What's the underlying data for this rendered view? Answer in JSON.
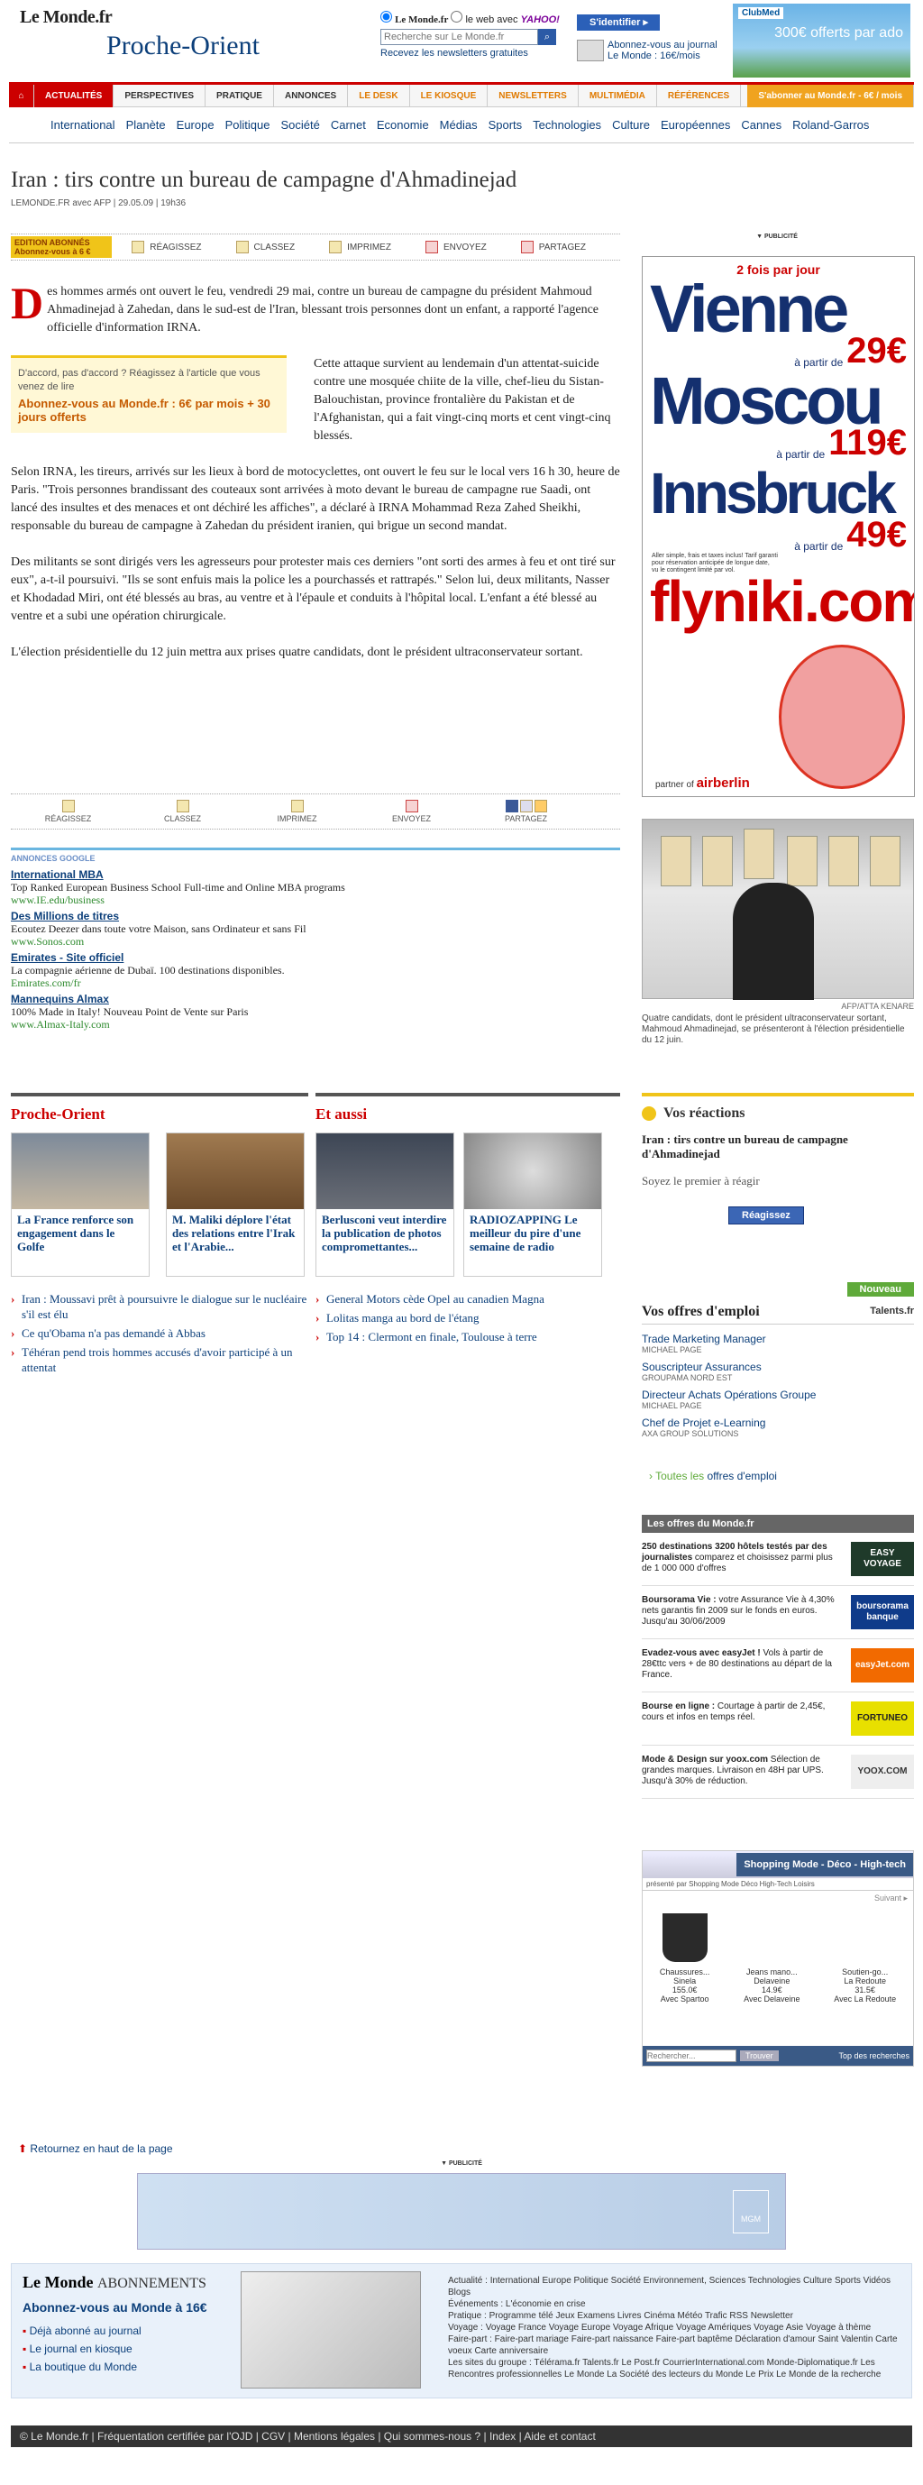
{
  "header": {
    "logo": "Le Monde.fr",
    "section": "Proche-Orient",
    "search_label_lemonde": "Le Monde.fr",
    "search_label_web": "le web avec",
    "yahoo": "YAHOO!",
    "search_placeholder": "Recherche sur Le Monde.fr",
    "newsletters": "Recevez les newsletters gratuites",
    "identify_button": "S'identifier ▸",
    "subscribe_text": "Abonnez-vous au journal Le Monde : 16€/mois",
    "ad_brand": "ClubMed",
    "ad_price": "300€ offerts par ado"
  },
  "nav": {
    "primary": [
      "ACTUALITÉS",
      "PERSPECTIVES",
      "PRATIQUE",
      "ANNONCES",
      "LE DESK",
      "LE KIOSQUE",
      "NEWSLETTERS",
      "MULTIMÉDIA",
      "RÉFÉRENCES"
    ],
    "subscribe": "S'abonner au Monde.fr - 6€ / mois",
    "secondary": [
      "International",
      "Planète",
      "Europe",
      "Politique",
      "Société",
      "Carnet",
      "Economie",
      "Médias",
      "Sports",
      "Technologies",
      "Culture",
      "Européennes",
      "Cannes",
      "Roland-Garros"
    ]
  },
  "article": {
    "title": "Iran : tirs contre un bureau de campagne d'Ahmadinejad",
    "meta": "LEMONDE.FR avec AFP | 29.05.09 | 19h36",
    "edition_badge": "EDITION ABONNÉS Abonnez-vous à 6 €",
    "tools": [
      "RÉAGISSEZ",
      "CLASSEZ",
      "IMPRIMEZ",
      "ENVOYEZ",
      "PARTAGEZ"
    ],
    "dropcap": "D",
    "p1": "es hommes armés ont ouvert le feu, vendredi 29 mai, contre un bureau de campagne du président Mahmoud Ahmadinejad à Zahedan, dans le sud-est de l'Iran, blessant trois personnes dont un enfant, a rapporté l'agence officielle d'information IRNA.",
    "react_q": "D'accord, pas d'accord ? Réagissez à l'article que vous venez de lire",
    "react_cta": "Abonnez-vous au Monde.fr : 6€ par mois + 30 jours offerts",
    "p2": "Cette attaque survient au lendemain d'un attentat-suicide contre une mosquée chiite de la ville, chef-lieu du Sistan-Balouchistan, province frontalière du Pakistan et de l'Afghanistan, qui a fait vingt-cinq morts et cent vingt-cinq blessés.",
    "p3": "Selon IRNA, les tireurs, arrivés sur les lieux à bord de motocyclettes, ont ouvert le feu sur le local vers 16 h 30, heure de Paris. \"Trois personnes brandissant des couteaux sont arrivées à moto devant le bureau de campagne rue Saadi, ont lancé des insultes et des menaces et ont déchiré les affiches\", a déclaré à IRNA Mohammad Reza Zahed Sheikhi, responsable du bureau de campagne à Zahedan du président iranien, qui brigue un second mandat.",
    "p4": "Des militants se sont dirigés vers les agresseurs pour protester mais ces derniers \"ont sorti des armes à feu et ont tiré sur eux\", a-t-il poursuivi. \"Ils se sont enfuis mais la police les a pourchassés et rattrapés.\" Selon lui, deux militants, Nasser et Khodadad Miri, ont été blessés au bras, au ventre et à l'épaule et conduits à l'hôpital local. L'enfant a été blessé au ventre et a subi une opération chirurgicale.",
    "p5": "L'élection présidentielle du 12 juin mettra aux prises quatre candidats, dont le président ultraconservateur sortant."
  },
  "ads": {
    "header": "ANNONCES GOOGLE",
    "items": [
      {
        "title": "International MBA",
        "desc": "Top Ranked European Business School Full-time and Online MBA programs",
        "url": "www.IE.edu/business"
      },
      {
        "title": "Des Millions de titres",
        "desc": "Ecoutez Deezer dans toute votre Maison, sans Ordinateur et sans Fil",
        "url": "www.Sonos.com"
      },
      {
        "title": "Emirates - Site officiel",
        "desc": "La compagnie aérienne de Dubaï. 100 destinations disponibles.",
        "url": "Emirates.com/fr"
      },
      {
        "title": "Mannequins Almax",
        "desc": "100% Made in Italy! Nouveau Point de Vente sur Paris",
        "url": "www.Almax-Italy.com"
      }
    ]
  },
  "sidebar": {
    "pub_label": "▼ PUBLICITÉ",
    "flyniki": {
      "top": "2 fois par jour",
      "cities": [
        {
          "name": "Vienne",
          "from": "à partir de",
          "price": "29€"
        },
        {
          "name": "Moscou",
          "from": "à partir de",
          "price": "119€"
        },
        {
          "name": "Innsbruck",
          "from": "à partir de",
          "price": "49€"
        }
      ],
      "small": "Aller simple, frais et taxes inclus! Tarif garanti pour réservation anticipée de longue date, vu le contingent limité par vol.",
      "brand": "flyniki.com",
      "partner": "partner of",
      "partner_brand": "airberlin"
    },
    "photo_credit": "AFP/ATTA KENARE",
    "photo_caption": "Quatre candidats, dont le président ultraconservateur sortant, Mahmoud Ahmadinejad, se présenteront à l'élection présidentielle du 12 juin."
  },
  "sections": {
    "po_title": "Proche-Orient",
    "po_cards": [
      "La France renforce son engagement dans le Golfe",
      "M. Maliki déplore l'état des relations entre l'Irak et l'Arabie..."
    ],
    "po_links": [
      "Iran : Moussavi prêt à poursuivre le dialogue sur le nucléaire s'il est élu",
      "Ce qu'Obama n'a pas demandé à Abbas",
      "Téhéran pend trois hommes accusés d'avoir participé à un attentat"
    ],
    "ea_title": "Et aussi",
    "ea_cards": [
      "Berlusconi veut interdire la publication de photos compromettantes...",
      "RADIOZAPPING Le meilleur du pire d'une semaine de radio"
    ],
    "ea_links": [
      "General Motors cède Opel au canadien Magna",
      "Lolitas manga au bord de l'étang",
      "Top 14 : Clermont en finale, Toulouse à terre"
    ]
  },
  "reactions": {
    "title": "Vos réactions",
    "article": "Iran : tirs contre un bureau de campagne d'Ahmadinejad",
    "first": "Soyez le premier à réagir",
    "button": "Réagissez"
  },
  "jobs": {
    "badge": "Nouveau",
    "title": "Vos offres d'emploi",
    "partner": "Talents.fr",
    "items": [
      {
        "title": "Trade Marketing Manager",
        "company": "MICHAEL PAGE"
      },
      {
        "title": "Souscripteur Assurances",
        "company": "GROUPAMA NORD EST"
      },
      {
        "title": "Directeur Achats Opérations Groupe",
        "company": "MICHAEL PAGE"
      },
      {
        "title": "Chef de Projet e-Learning",
        "company": "AXA GROUP SOLUTIONS"
      }
    ],
    "all_prefix": "› Toutes les",
    "all_link": "offres d'emploi"
  },
  "offres": {
    "title": "Les offres du Monde.fr",
    "items": [
      {
        "bold": "250 destinations 3200 hôtels testés par des journalistes",
        "text": " comparez et choisissez parmi plus de 1 000 000 d'offres",
        "logo": "EASY VOYAGE",
        "bg": "#1f3a2a",
        "fg": "#ffffff"
      },
      {
        "bold": "Boursorama Vie :",
        "text": " votre Assurance Vie à 4,30% nets garantis fin 2009 sur le fonds en euros. Jusqu'au 30/06/2009",
        "logo": "boursorama banque",
        "bg": "#0f3b8a",
        "fg": "#ffffff"
      },
      {
        "bold": "Evadez-vous avec easyJet !",
        "text": " Vols à partir de 28€ttc vers + de 80 destinations au départ de la France.",
        "logo": "easyJet.com",
        "bg": "#f26a00",
        "fg": "#ffffff"
      },
      {
        "bold": "Bourse en ligne :",
        "text": " Courtage à partir de 2,45€, cours et infos en temps réel.",
        "logo": "FORTUNEO",
        "bg": "#e8e000",
        "fg": "#222222"
      },
      {
        "bold": "Mode & Design sur yoox.com",
        "text": " Sélection de grandes marques. Livraison en 48H par UPS. Jusqu'à 30% de réduction.",
        "logo": "YOOX.COM",
        "bg": "#eeeeee",
        "fg": "#333333"
      }
    ]
  },
  "shop": {
    "title": "Shopping Mode - Déco - High-tech",
    "tabs": [
      "présenté par Shopping",
      "Mode",
      "Déco",
      "High-Tech",
      "Loisirs"
    ],
    "next": "Suivant ▸",
    "products": [
      {
        "name": "Chaussures...",
        "brand": "Sinela",
        "price": "155.0€",
        "shop": "Avec Spartoo"
      },
      {
        "name": "Jeans mano...",
        "brand": "Delaveine",
        "price": "14.9€",
        "shop": "Avec Delaveine"
      },
      {
        "name": "Soutien-go...",
        "brand": "La Redoute",
        "price": "31.5€",
        "shop": "Avec La Redoute"
      }
    ],
    "search_placeholder": "Rechercher...",
    "search_btn": "Trouver",
    "top": "Top des recherches"
  },
  "footer": {
    "backtop": "Retournez en haut de la page",
    "pub_label": "▼ PUBLICITÉ",
    "banner_logo": "MGM",
    "lm_logo": "Le Monde",
    "lm_sub": "ABONNEMENTS",
    "abo": "Abonnez-vous au Monde à 16€",
    "links": [
      "Déjà abonné au journal",
      "Le journal en kiosque",
      "La boutique du Monde"
    ],
    "rubriques": "Actualité : International Europe Politique Société Environnement, Sciences Technologies Culture Sports Vidéos Blogs",
    "evenements": "Événements : L'économie en crise",
    "pratique": "Pratique : Programme télé Jeux Examens Livres Cinéma Météo Trafic RSS Newsletter",
    "voyage": "Voyage : Voyage France Voyage Europe Voyage Afrique Voyage Amériques Voyage Asie Voyage à thème",
    "fairepart": "Faire-part : Faire-part mariage Faire-part naissance Faire-part baptême Déclaration d'amour Saint Valentin Carte voeux Carte anniversaire",
    "groupe": "Les sites du groupe : Télérama.fr Talents.fr Le Post.fr CourrierInternational.com Monde-Diplomatique.fr Les Rencontres professionnelles Le Monde La Société des lecteurs du Monde Le Prix Le Monde de la recherche",
    "bottom": "© Le Monde.fr | Fréquentation certifiée par l'OJD | CGV | Mentions légales | Qui sommes-nous ? | Index | Aide et contact"
  }
}
